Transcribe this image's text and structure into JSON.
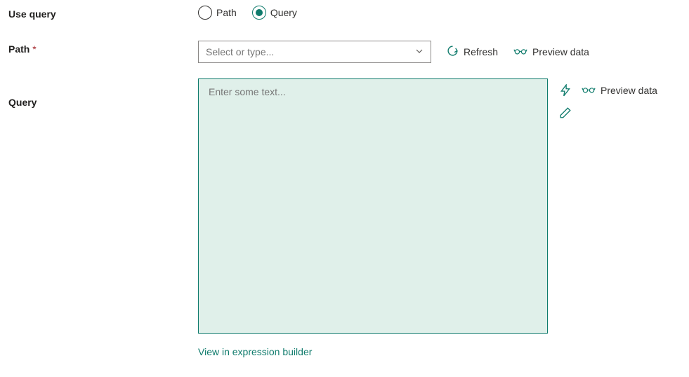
{
  "labels": {
    "use_query": "Use query",
    "path": "Path",
    "path_required": "*",
    "query": "Query"
  },
  "radio": {
    "path": "Path",
    "query": "Query"
  },
  "path_select": {
    "placeholder": "Select or type..."
  },
  "actions": {
    "refresh": "Refresh",
    "preview_data": "Preview data",
    "preview_data_query": "Preview data"
  },
  "query_textarea": {
    "placeholder": "Enter some text..."
  },
  "links": {
    "expression_builder": "View in expression builder"
  }
}
